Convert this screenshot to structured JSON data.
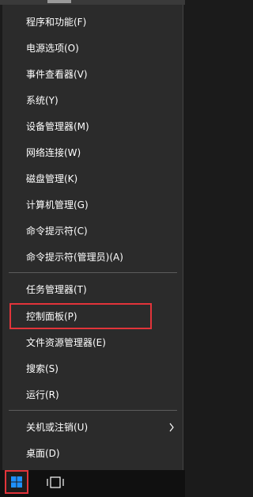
{
  "menu": {
    "items": [
      {
        "label": "程序和功能(F)"
      },
      {
        "label": "电源选项(O)"
      },
      {
        "label": "事件查看器(V)"
      },
      {
        "label": "系统(Y)"
      },
      {
        "label": "设备管理器(M)"
      },
      {
        "label": "网络连接(W)"
      },
      {
        "label": "磁盘管理(K)"
      },
      {
        "label": "计算机管理(G)"
      },
      {
        "label": "命令提示符(C)"
      },
      {
        "label": "命令提示符(管理员)(A)"
      },
      {
        "label": "任务管理器(T)"
      },
      {
        "label": "控制面板(P)"
      },
      {
        "label": "文件资源管理器(E)"
      },
      {
        "label": "搜索(S)"
      },
      {
        "label": "运行(R)"
      },
      {
        "label": "关机或注销(U)",
        "icon": "chevron-right-icon"
      },
      {
        "label": "桌面(D)"
      }
    ]
  },
  "taskbar": {
    "start_icon": "windows-logo-icon",
    "taskview_icon": "task-view-icon"
  },
  "colors": {
    "menu_bg": "#2b2b2b",
    "text": "#ffffff",
    "separator": "#5c5c5c",
    "highlight_border": "#e2343a",
    "start_logo": "#1e90ff"
  }
}
